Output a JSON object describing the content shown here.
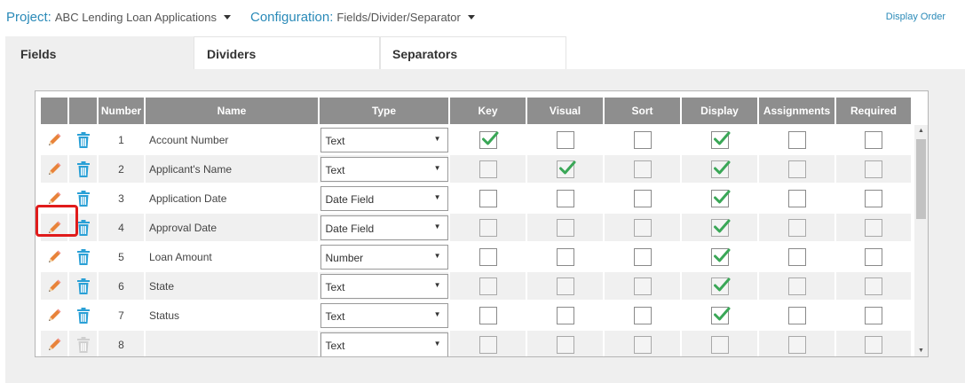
{
  "header": {
    "project_label": "Project:",
    "project_value": "ABC Lending Loan Applications",
    "config_label": "Configuration:",
    "config_value": "Fields/Divider/Separator",
    "display_order": "Display Order"
  },
  "tabs": [
    {
      "label": "Fields",
      "active": true
    },
    {
      "label": "Dividers",
      "active": false
    },
    {
      "label": "Separators",
      "active": false
    }
  ],
  "columns": [
    "Number",
    "Name",
    "Type",
    "Key",
    "Visual",
    "Sort",
    "Display",
    "Assignments",
    "Required"
  ],
  "rows": [
    {
      "number": "1",
      "name": "Account Number",
      "type": "Text",
      "key": true,
      "visual": false,
      "sort": false,
      "display": true,
      "assignments": false,
      "required": false
    },
    {
      "number": "2",
      "name": "Applicant's Name",
      "type": "Text",
      "key": false,
      "visual": true,
      "sort": false,
      "display": true,
      "assignments": false,
      "required": false
    },
    {
      "number": "3",
      "name": "Application Date",
      "type": "Date Field",
      "key": false,
      "visual": false,
      "sort": false,
      "display": true,
      "assignments": false,
      "required": false
    },
    {
      "number": "4",
      "name": "Approval Date",
      "type": "Date Field",
      "key": false,
      "visual": false,
      "sort": false,
      "display": true,
      "assignments": false,
      "required": false
    },
    {
      "number": "5",
      "name": "Loan Amount",
      "type": "Number",
      "key": false,
      "visual": false,
      "sort": false,
      "display": true,
      "assignments": false,
      "required": false
    },
    {
      "number": "6",
      "name": "State",
      "type": "Text",
      "key": false,
      "visual": false,
      "sort": false,
      "display": true,
      "assignments": false,
      "required": false
    },
    {
      "number": "7",
      "name": "Status",
      "type": "Text",
      "key": false,
      "visual": false,
      "sort": false,
      "display": true,
      "assignments": false,
      "required": false
    },
    {
      "number": "8",
      "name": "",
      "type": "Text",
      "key": false,
      "visual": false,
      "sort": false,
      "display": false,
      "assignments": false,
      "required": false
    }
  ],
  "disabled_delete_rows": [
    7
  ],
  "highlighted_row": 3,
  "colors": {
    "accent": "#2a8ab8",
    "check": "#3aa757",
    "pencil": "#e8833a",
    "trash": "#2aa0d6",
    "highlight": "#e01b1b"
  },
  "icons": {
    "edit": "pencil-icon",
    "delete": "trash-icon"
  }
}
